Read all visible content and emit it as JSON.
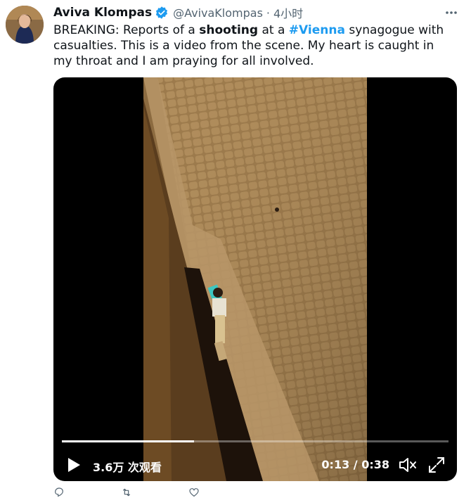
{
  "user": {
    "display_name": "Aviva Klompas",
    "handle": "@AvivaKlompas",
    "separator": "·",
    "time": "4小时"
  },
  "tweet": {
    "text_1": "BREAKING: Reports of a ",
    "bold_1": "shooting",
    "text_2": " at a ",
    "hashtag": "#Vienna",
    "text_3": " synagogue with casualties. This is a video from the scene. My heart is caught in my throat and I am praying for all involved."
  },
  "video": {
    "views": "3.6万 次观看",
    "time_elapsed": "0:13",
    "time_separator": " / ",
    "time_total": "0:38",
    "progress": 0.342
  },
  "icons": {
    "verified": "verified-badge-icon",
    "more": "more-dots-icon",
    "play": "play-icon",
    "mute": "muted-speaker-icon",
    "fullscreen": "fullscreen-icon",
    "reply": "reply-icon",
    "retweet": "retweet-icon",
    "like": "like-icon"
  },
  "colors": {
    "accent": "#1d9bf0",
    "secondary_text": "#536471",
    "text": "#0f1419"
  }
}
